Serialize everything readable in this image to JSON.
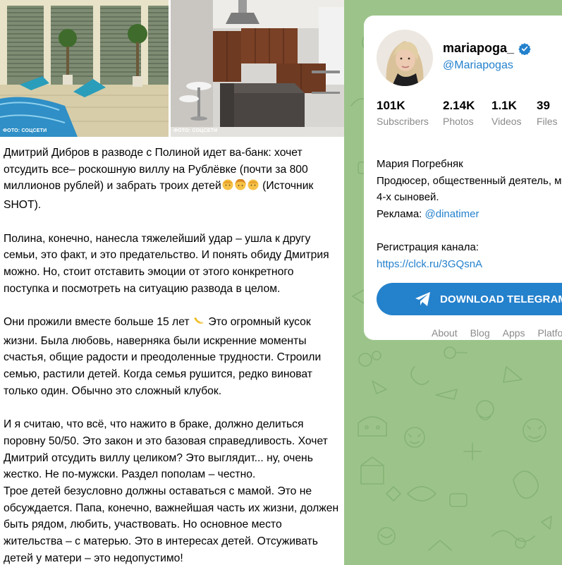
{
  "post": {
    "images": [
      {
        "caption": "ФОТО: СОЦСЕТИ"
      },
      {
        "caption": "ФОТО: СОЦСЕТИ"
      }
    ],
    "p1_start": "Дмитрий Дибров в разводе с Полиной идет ва-банк: хочет отсудить все– роскошную виллу на Рублёвке (почти за 800 миллионов рублей) и забрать троих детей",
    "p1_end": " (Источник SHOT).",
    "p2": "Полина, конечно, нанесла тяжелейший удар – ушла к другу семьи, это факт, и это предательство. И понять обиду Дмитрия можно. Но, стоит отставить эмоции от этого конкретного поступка и посмотреть на ситуацию развода в целом.",
    "p3_start": "Они прожили вместе больше 15 лет",
    "p3_end": " Это огромный кусок жизни. Была любовь, наверняка были искренние моменты счастья, общие радости и преодоленные трудности. Строили семью, растили детей. Когда семья рушится, редко виноват только один. Обычно это сложный клубок.",
    "p4": "И я считаю, что всё, что нажито в браке, должно делиться поровну 50/50. Это закон и это базовая справедливость. Хочет Дмитрий отсудить виллу целиком? Это выглядит... ну, очень жестко. Не по-мужски. Раздел пополам – честно.",
    "p5": "Трое детей безусловно должны оставаться с мамой. Это не обсуждается. Папа, конечно, важнейшая часть их жизни, должен быть рядом, любить, участвовать. Но основное место жительства – с матерью. Это в интересах детей. Отсуживать детей у матери – это недопустимо!"
  },
  "channel": {
    "name": "mariapoga_",
    "handle": "@Mariapogas",
    "stats": [
      {
        "value": "101K",
        "label": "Subscribers"
      },
      {
        "value": "2.14K",
        "label": "Photos"
      },
      {
        "value": "1.1K",
        "label": "Videos"
      },
      {
        "value": "39",
        "label": "Files"
      }
    ],
    "bio_name": "Мария Погребняк",
    "bio_role": "Продюсер, общественный деятель, мама",
    "bio_sons": "4-х сыновей.",
    "ads_label": "Реклама: ",
    "ads_link": "@dinatimer",
    "reg_label": "Регистрация канала:",
    "reg_link": "https://clck.ru/3GQsnA",
    "download_label": "DOWNLOAD TELEGRAM",
    "footer": [
      "About",
      "Blog",
      "Apps",
      "Platform"
    ],
    "colors": {
      "accent": "#2481cc",
      "panel_bg": "#9cc48a"
    }
  }
}
